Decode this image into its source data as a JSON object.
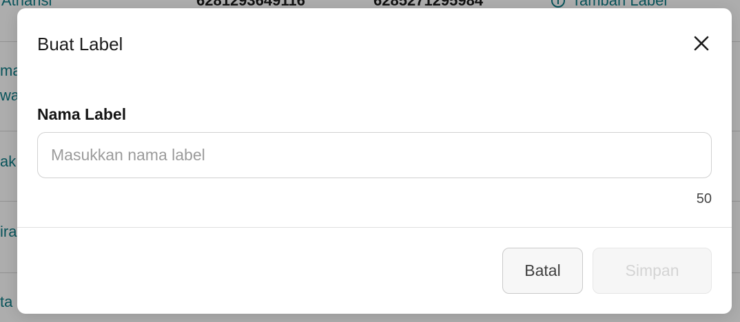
{
  "background": {
    "row1": {
      "name": "Atharisi",
      "phone_1": "6281293649116",
      "phone_2": "6285271295984",
      "action_label": "Tambah Label"
    },
    "side_fragments": [
      "ma",
      "wa",
      "ak",
      "ira",
      "ta"
    ]
  },
  "modal": {
    "title": "Buat Label",
    "close_icon": "close-icon",
    "field": {
      "label": "Nama Label",
      "value": "",
      "placeholder": "Masukkan nama label",
      "char_limit": "50"
    },
    "buttons": {
      "cancel": "Batal",
      "save": "Simpan",
      "save_disabled": true
    }
  },
  "colors": {
    "accent": "#0e7c86",
    "overlay": "rgba(0,0,0,0.32)",
    "text_primary": "#1b1b1b",
    "border": "#d0d0d0",
    "disabled_text": "#d4d4d4"
  }
}
